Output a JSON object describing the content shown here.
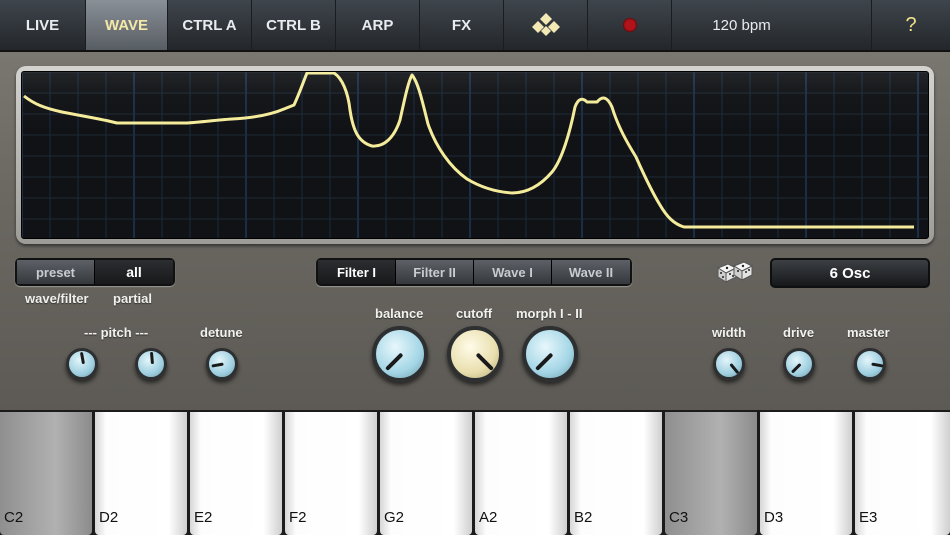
{
  "nav": {
    "tabs": [
      {
        "label": "LIVE",
        "active": false
      },
      {
        "label": "WAVE",
        "active": true
      },
      {
        "label": "CTRL A",
        "active": false
      },
      {
        "label": "CTRL B",
        "active": false
      },
      {
        "label": "ARP",
        "active": false
      },
      {
        "label": "FX",
        "active": false
      }
    ],
    "logo_icon": "diamond-grid-logo-icon",
    "record_icon": "record-icon",
    "record_color": "#b0141a",
    "bpm": "120 bpm",
    "help": "?"
  },
  "display": {
    "waveform_color": "#f4ec9a",
    "grid_color": "#1b3b63"
  },
  "wave_selector": {
    "options": [
      "preset",
      "all"
    ],
    "selected": "all",
    "labels": [
      "wave/filter",
      "partial"
    ]
  },
  "mode_selector": {
    "options": [
      "Filter I",
      "Filter II",
      "Wave I",
      "Wave II"
    ],
    "selected": "Filter I"
  },
  "knobs": {
    "pitch_label": "--- pitch ---",
    "detune": "detune",
    "balance": "balance",
    "cutoff": "cutoff",
    "morph": "morph I - II",
    "width": "width",
    "drive": "drive",
    "master": "master"
  },
  "dice_icon": "dice-icon",
  "osc_count": "6 Osc",
  "keyboard": {
    "keys": [
      {
        "label": "C2",
        "pressed": true
      },
      {
        "label": "D2",
        "pressed": false
      },
      {
        "label": "E2",
        "pressed": false
      },
      {
        "label": "F2",
        "pressed": false
      },
      {
        "label": "G2",
        "pressed": false
      },
      {
        "label": "A2",
        "pressed": false
      },
      {
        "label": "B2",
        "pressed": false
      },
      {
        "label": "C3",
        "pressed": true
      },
      {
        "label": "D3",
        "pressed": false
      },
      {
        "label": "E3",
        "pressed": false
      }
    ]
  },
  "colors": {
    "accent": "#f5e9a8",
    "knob_blue": "#a4d6e6",
    "knob_cream": "#e9dfae"
  }
}
